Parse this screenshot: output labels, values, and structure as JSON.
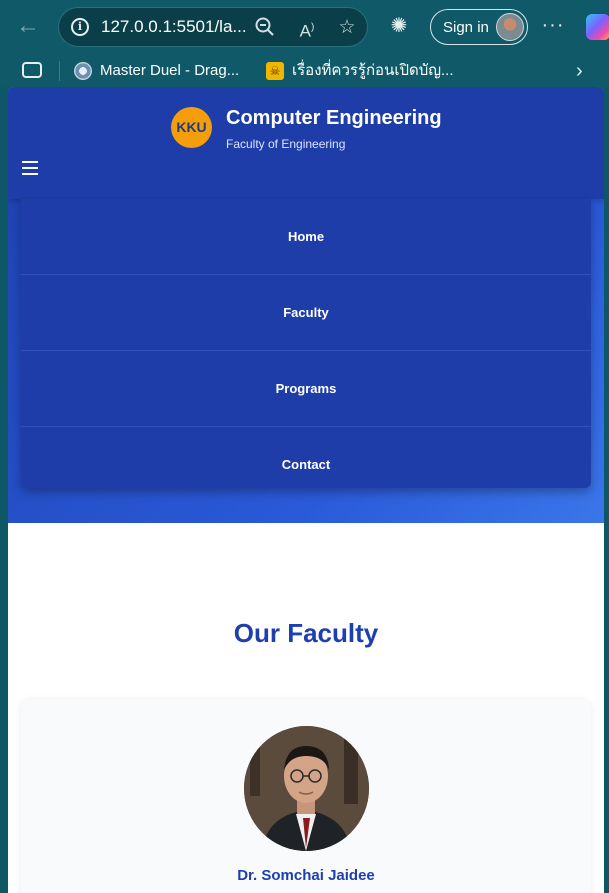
{
  "browser": {
    "url": "127.0.0.1:5501/la...",
    "sign_in_label": "Sign in",
    "icons": {
      "back": "back-arrow-icon",
      "info": "info-icon",
      "zoom": "zoom-out-icon",
      "read_aloud": "read-aloud-icon",
      "favorite": "star-icon",
      "extensions": "extensions-icon",
      "more": "more-icon",
      "copilot": "copilot-icon"
    },
    "bookmarks": [
      {
        "label": "Master Duel - Drag...",
        "icon": "game-favicon"
      },
      {
        "label": "เรื่องที่ควรรู้ก่อนเปิดบัญ...",
        "icon": "bank-favicon"
      }
    ]
  },
  "site": {
    "logo_text": "KKU",
    "title": "Computer Engineering",
    "subtitle": "Faculty of Engineering",
    "brand_color": "#1e40af",
    "accent_color": "#f59e0b"
  },
  "nav": {
    "items": [
      {
        "label": "Home"
      },
      {
        "label": "Faculty"
      },
      {
        "label": "Programs"
      },
      {
        "label": "Contact"
      }
    ]
  },
  "main": {
    "section_title": "Our Faculty",
    "faculty": [
      {
        "name": "Dr. Somchai Jaidee"
      }
    ]
  }
}
